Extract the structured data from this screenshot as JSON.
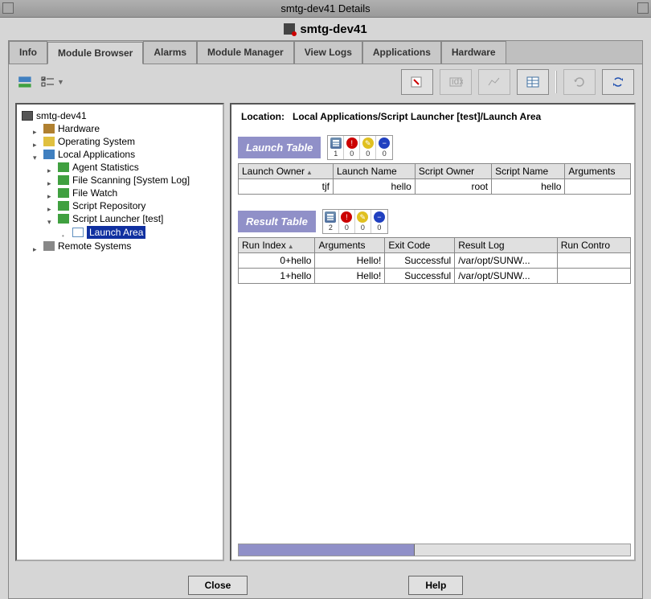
{
  "window": {
    "title": "smtg-dev41 Details"
  },
  "sub_title": "smtg-dev41",
  "tabs": [
    {
      "label": "Info"
    },
    {
      "label": "Module Browser"
    },
    {
      "label": "Alarms"
    },
    {
      "label": "Module Manager"
    },
    {
      "label": "View Logs"
    },
    {
      "label": "Applications"
    },
    {
      "label": "Hardware"
    }
  ],
  "active_tab_index": 1,
  "tree": {
    "root": "smtg-dev41",
    "items": [
      {
        "label": "Hardware",
        "depth": 2,
        "icon": "ti-hw",
        "toggle": "closed"
      },
      {
        "label": "Operating System",
        "depth": 2,
        "icon": "ti-os",
        "toggle": "closed"
      },
      {
        "label": "Local Applications",
        "depth": 2,
        "icon": "ti-app",
        "toggle": "open"
      },
      {
        "label": "Agent Statistics",
        "depth": 3,
        "icon": "ti-green",
        "toggle": "closed"
      },
      {
        "label": "File Scanning [System Log]",
        "depth": 3,
        "icon": "ti-green",
        "toggle": "closed"
      },
      {
        "label": "File Watch",
        "depth": 3,
        "icon": "ti-green",
        "toggle": "closed"
      },
      {
        "label": "Script Repository",
        "depth": 3,
        "icon": "ti-green",
        "toggle": "closed"
      },
      {
        "label": "Script Launcher [test]",
        "depth": 3,
        "icon": "ti-green",
        "toggle": "open"
      },
      {
        "label": "Launch Area",
        "depth": 4,
        "icon": "ti-table",
        "toggle": "leaf",
        "selected": true
      },
      {
        "label": "Remote Systems",
        "depth": 2,
        "icon": "ti-remote",
        "toggle": "closed"
      }
    ]
  },
  "location": {
    "label": "Location:",
    "path": "Local Applications/Script Launcher [test]/Launch Area"
  },
  "launch_table": {
    "title": "Launch Table",
    "status": [
      {
        "kind": "table",
        "count": "1"
      },
      {
        "kind": "red",
        "glyph": "!",
        "count": "0"
      },
      {
        "kind": "yellow",
        "glyph": "✎",
        "count": "0"
      },
      {
        "kind": "blue",
        "glyph": "−",
        "count": "0"
      }
    ],
    "columns": [
      "Launch Owner",
      "Launch Name",
      "Script Owner",
      "Script Name",
      "Arguments"
    ],
    "sort_col": 0,
    "rows": [
      [
        "tjf",
        "hello",
        "root",
        "hello",
        ""
      ]
    ]
  },
  "result_table": {
    "title": "Result Table",
    "status": [
      {
        "kind": "table",
        "count": "2"
      },
      {
        "kind": "red",
        "glyph": "!",
        "count": "0"
      },
      {
        "kind": "yellow",
        "glyph": "✎",
        "count": "0"
      },
      {
        "kind": "blue",
        "glyph": "−",
        "count": "0"
      }
    ],
    "columns": [
      "Run Index",
      "Arguments",
      "Exit Code",
      "Result Log",
      "Run Contro"
    ],
    "sort_col": 0,
    "rows": [
      [
        "0+hello",
        "Hello!",
        "Successful",
        "/var/opt/SUNW...",
        ""
      ],
      [
        "1+hello",
        "Hello!",
        "Successful",
        "/var/opt/SUNW...",
        ""
      ]
    ]
  },
  "buttons": {
    "close": "Close",
    "help": "Help"
  },
  "toolbar": {
    "module_icon": "module-icon",
    "checklist_icon": "checklist-icon",
    "props_icon": "props-icon",
    "idx_icon": "idx-icon",
    "chart_icon": "chart-icon",
    "table_icon": "table-icon",
    "refresh_icon": "refresh-icon",
    "reload_icon": "reload-icon"
  }
}
